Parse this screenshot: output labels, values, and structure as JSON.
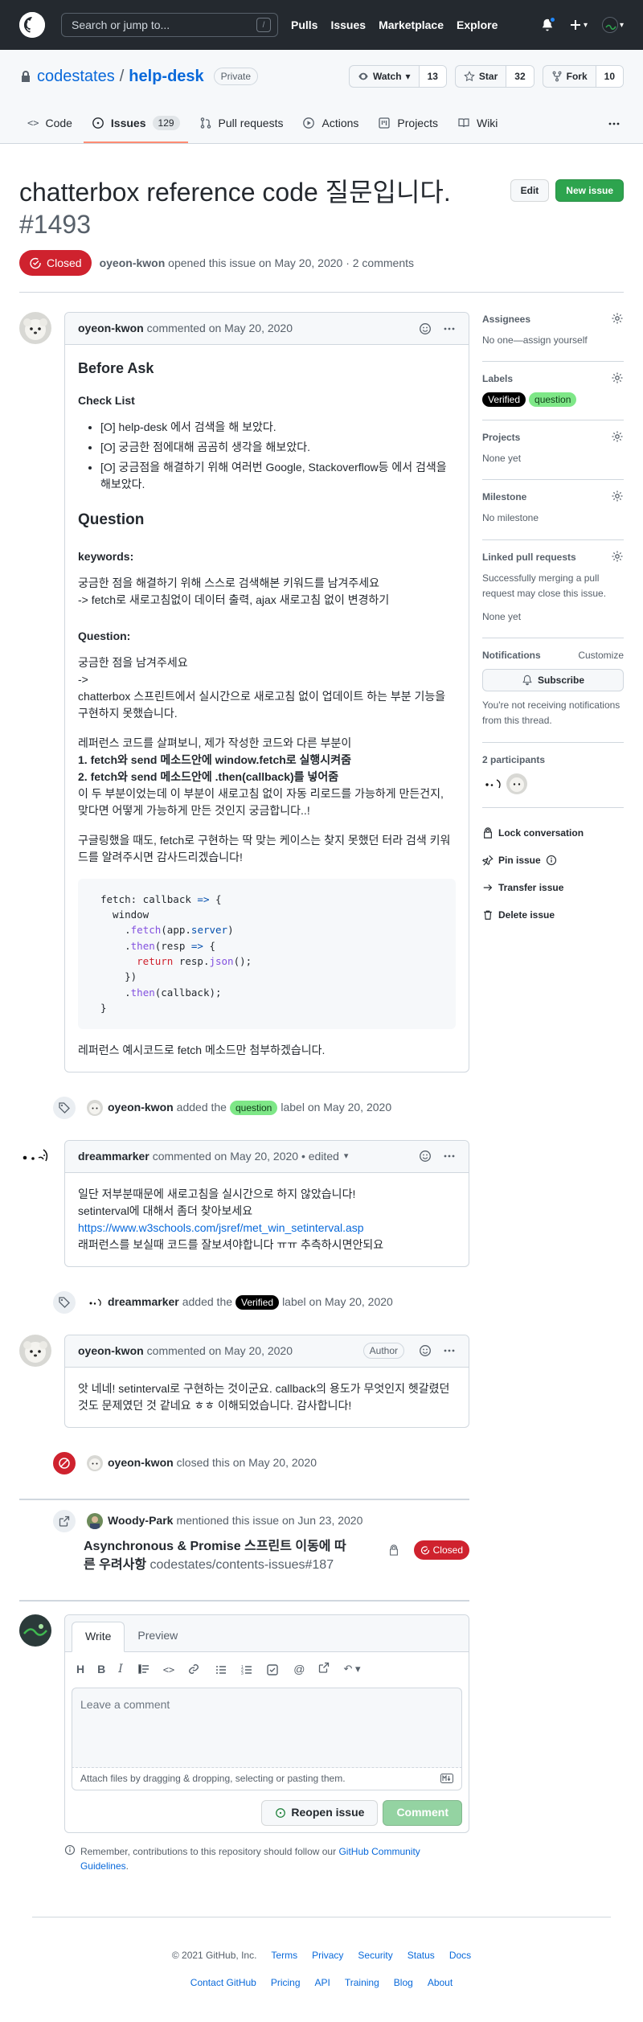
{
  "header": {
    "search_placeholder": "Search or jump to...",
    "slash_key": "/",
    "nav": [
      "Pulls",
      "Issues",
      "Marketplace",
      "Explore"
    ]
  },
  "repo": {
    "owner": "codestates",
    "separator": "/",
    "name": "help-desk",
    "visibility": "Private",
    "watch": {
      "label": "Watch",
      "count": "13"
    },
    "star": {
      "label": "Star",
      "count": "32"
    },
    "fork": {
      "label": "Fork",
      "count": "10"
    },
    "tabs": [
      {
        "label": "Code"
      },
      {
        "label": "Issues",
        "count": "129"
      },
      {
        "label": "Pull requests"
      },
      {
        "label": "Actions"
      },
      {
        "label": "Projects"
      },
      {
        "label": "Wiki"
      }
    ]
  },
  "issue": {
    "title": "chatterbox reference code 질문입니다.",
    "number": "#1493",
    "edit_label": "Edit",
    "new_issue_label": "New issue",
    "state": "Closed",
    "author": "oyeon-kwon",
    "meta_text": "opened this issue on May 20, 2020 · 2 comments"
  },
  "comment1": {
    "author": "oyeon-kwon",
    "when": "commented on May 20, 2020",
    "h_before": "Before Ask",
    "h_checklist": "Check List",
    "checklist": [
      "[O] help-desk 에서 검색을 해 보았다.",
      "[O] 궁금한 점에대해 곰곰히 생각을 해보았다.",
      "[O] 궁금점을 해결하기 위해 여러번 Google, Stackoverflow등 에서 검색을 해보았다."
    ],
    "h_question": "Question",
    "h_keywords": "keywords:",
    "keywords_1": "궁금한 점을 해결하기 위해 스스로 검색해본 키워드를 남겨주세요",
    "keywords_2": "-> fetch로 새로고침없이 데이터 출력, ajax 새로고침 없이 변경하기",
    "h_question2": "Question:",
    "q_1": "궁금한 점을 남겨주세요",
    "q_2": "->",
    "q_3": "chatterbox 스프린트에서 실시간으로 새로고침 없이 업데이트 하는 부분 기능을 구현하지 못했습니다.",
    "p2_1": "레퍼런스 코드를 살펴보니, 제가 작성한 코드와 다른 부분이",
    "p2_2": "1. fetch와 send 메소드안에 window.fetch로 실행시켜줌",
    "p2_3": "2. fetch와 send 메소드안에 .then(callback)를 넣어줌",
    "p2_4": "이 두 부분이었는데 이 부분이 새로고침 없이 자동 리로드를 가능하게 만든건지, 맞다면 어떻게 가능하게 만든 것인지 궁금합니다..!",
    "p3": "구글링했을 때도, fetch로 구현하는 딱 맞는 케이스는 찾지 못했던 터라 검색 키워드를 알려주시면 감사드리겠습니다!",
    "code": {
      "l1a": "fetch: callback ",
      "l1b": "=>",
      "l1c": " {",
      "l2": "  window",
      "l3a": "    .",
      "l3b": "fetch",
      "l3c": "(app.",
      "l3d": "server",
      "l3e": ")",
      "l4a": "    .",
      "l4b": "then",
      "l4c": "(resp ",
      "l4d": "=>",
      "l4e": " {",
      "l5a": "      ",
      "l5b": "return",
      "l5c": " resp.",
      "l5d": "json",
      "l5e": "();",
      "l6": "    })",
      "l7a": "    .",
      "l7b": "then",
      "l7c": "(callback);",
      "l8": "}"
    },
    "p4": "레퍼런스 예시코드로 fetch 메소드만 첨부하겠습니다."
  },
  "event1": {
    "actor": "oyeon-kwon",
    "pre": "added the",
    "label": "question",
    "post": "label on May 20, 2020"
  },
  "comment2": {
    "author": "dreammarker",
    "when": "commented on May 20, 2020 • edited",
    "line1": "일단 저부분때문에 새로고침을 실시간으로 하지 않았습니다!",
    "line2": "setinterval에 대해서 좀더 찾아보세요",
    "link": "https://www.w3schools.com/jsref/met_win_setinterval.asp",
    "line4": "래퍼런스를 보실때 코드를 잘보셔야합니다 ㅠㅠ 추측하시면안되요"
  },
  "event2": {
    "actor": "dreammarker",
    "pre": "added the",
    "label": "Verified",
    "post": "label on May 20, 2020"
  },
  "comment3": {
    "author": "oyeon-kwon",
    "when": "commented on May 20, 2020",
    "badge": "Author",
    "body": "앗 네네! setinterval로 구현하는 것이군요. callback의 용도가 무엇인지 헷갈렸던 것도 문제였던 것 같네요 ㅎㅎ 이해되었습니다. 감사합니다!"
  },
  "event3": {
    "actor": "oyeon-kwon",
    "text": "closed this on May 20, 2020"
  },
  "xref": {
    "actor": "Woody-Park",
    "text": "mentioned this issue on Jun 23, 2020",
    "title": "Asynchronous & Promise 스프린트 이동에 따른 우려사항",
    "ref": "codestates/contents-issues#187",
    "state": "Closed"
  },
  "editor": {
    "tab_write": "Write",
    "tab_preview": "Preview",
    "placeholder": "Leave a comment",
    "attach": "Attach files by dragging & dropping, selecting or pasting them.",
    "reopen": "Reopen issue",
    "comment": "Comment",
    "remember_pre": "Remember, contributions to this repository should follow our",
    "remember_link": "GitHub Community Guidelines",
    "remember_post": "."
  },
  "sidebar": {
    "assignees": {
      "heading": "Assignees",
      "value": "No one—assign yourself"
    },
    "labels": {
      "heading": "Labels",
      "items": [
        "Verified",
        "question"
      ]
    },
    "projects": {
      "heading": "Projects",
      "value": "None yet"
    },
    "milestone": {
      "heading": "Milestone",
      "value": "No milestone"
    },
    "linked": {
      "heading": "Linked pull requests",
      "desc": "Successfully merging a pull request may close this issue.",
      "value": "None yet"
    },
    "notifications": {
      "heading": "Notifications",
      "customize": "Customize",
      "subscribe": "Subscribe",
      "desc": "You're not receiving notifications from this thread."
    },
    "participants": {
      "heading": "2 participants"
    },
    "actions": [
      "Lock conversation",
      "Pin issue",
      "Transfer issue",
      "Delete issue"
    ]
  },
  "footer": {
    "copyright": "© 2021 GitHub, Inc.",
    "row1": [
      "Terms",
      "Privacy",
      "Security",
      "Status",
      "Docs"
    ],
    "row2": [
      "Contact GitHub",
      "Pricing",
      "API",
      "Training",
      "Blog",
      "About"
    ]
  },
  "colors": {
    "header_bg": "#24292f",
    "closed_red": "#cf222e",
    "question_label": "#7ee787",
    "verified_label": "#000000",
    "primary_green": "#2da44e",
    "link_blue": "#0969da"
  }
}
